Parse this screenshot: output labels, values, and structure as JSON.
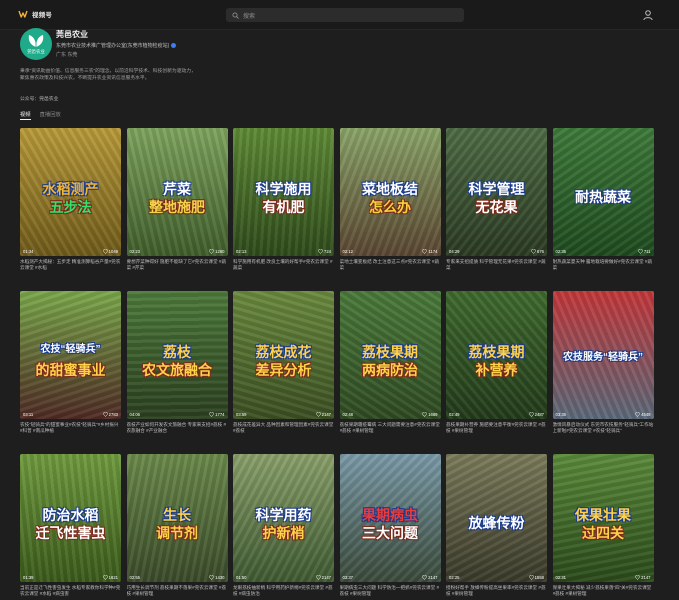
{
  "brand": {
    "name": "视频号"
  },
  "search": {
    "placeholder": "搜索"
  },
  "profile": {
    "avatar_text": "莞邑农业",
    "name": "莞邑农业",
    "desc": "东莞市农业技术推广管理办公室(东莞市植物检疫站)",
    "location": "广东 东莞",
    "bio": "秉承“资讯助益价值、信息服务三农”的理念，以前沿科学技术、科技创新为驱动力，聚焦惠农政策及科技兴农，不断提升农业资讯信息服务水平。",
    "company_label": "公众号：",
    "company_value": "莞邑农业"
  },
  "tabs": [
    {
      "label": "视频",
      "active": true
    },
    {
      "label": "直播回放",
      "active": false
    }
  ],
  "videos": [
    {
      "title_l1": "水稻测产",
      "title_l2": "五步法",
      "duration": "01:34",
      "likes": "1049",
      "caption": "水稻测产大揭秘：五步走 精准测算稻谷产量#莞农云课堂 #水稻",
      "bg": "#b99a3a",
      "bg2": "#6f5a1a",
      "c1": "#f2b533",
      "c2": "#34e26b"
    },
    {
      "title_l1": "芹菜",
      "title_l2": "整地施肥",
      "duration": "02:23",
      "likes": "1260",
      "caption": "要想芹菜种得好 施肥不能缺了它#莞农云课堂 #蔬菜 #芹菜",
      "bg": "#7ea35e",
      "bg2": "#3f5d2a",
      "c1": "#ffffff",
      "c2": "#f2d34a"
    },
    {
      "title_l1": "科学施用",
      "title_l2": "有机肥",
      "duration": "02:13",
      "likes": "724",
      "caption": "科学施用有机肥 改良土壤的好帮手#莞农云课堂 #蔬菜",
      "bg": "#5e8a35",
      "bg2": "#2e4a1a",
      "c1": "#ffffff",
      "c2": "#ffffff"
    },
    {
      "title_l1": "菜地板结",
      "title_l2": "怎么办",
      "duration": "02:12",
      "likes": "1174",
      "caption": "菜地土壤变板结 改土注意这三点#莞农云课堂 #蔬菜",
      "bg": "#8aa468",
      "bg2": "#5a4632",
      "c1": "#ffffff",
      "c2": "#f5d23a"
    },
    {
      "title_l1": "科学管理",
      "title_l2": "无花果",
      "duration": "04:29",
      "likes": "676",
      "caption": "专家来支招提质 科学管理无花果#莞农云课堂 #蔬菜",
      "bg": "#4e6b44",
      "bg2": "#2a3a22",
      "c1": "#ffffff",
      "c2": "#ffffff"
    },
    {
      "title_l1": "耐热蔬菜",
      "title_l2": "",
      "duration": "02:35",
      "likes": "711",
      "caption": "耐热蔬菜夏天种 露地栽培要做好#莞农云课堂 #蔬菜",
      "bg": "#3e7a3a",
      "bg2": "#1e4a1e",
      "c1": "#ffffff",
      "c2": "#ffffff"
    },
    {
      "title_l1": "农技“轻骑兵”",
      "title_l2": "的甜蜜事业",
      "duration": "03:11",
      "likes": "2783",
      "caption": "农技“轻骑兵”的甜蜜事业#农技“轻骑兵”#乡村振兴 #科普 #南瓜种植",
      "bg": "#7aa84a",
      "bg2": "#4e2a24",
      "c1": "#ffffff",
      "c2": "#ffd24a"
    },
    {
      "title_l1": "荔枝",
      "title_l2": "农文旅融合",
      "duration": "04:06",
      "likes": "1774",
      "caption": "荔枝产业如何开发农文旅融合 专家来支招#荔枝 #农旅融合 #产业融合",
      "bg": "#4c7a3a",
      "bg2": "#2b3f1f",
      "c1": "#ffd24a",
      "c2": "#ffd24a"
    },
    {
      "title_l1": "荔枝成花",
      "title_l2": "差异分析",
      "duration": "03:59",
      "likes": "2147",
      "caption": "荔枝成花差异大 品种因素和管理因素#莞农云课堂 #荔枝",
      "bg": "#6a8a3e",
      "bg2": "#3b4f22",
      "c1": "#ffd24a",
      "c2": "#ffd24a"
    },
    {
      "title_l1": "荔枝果期",
      "title_l2": "两病防治",
      "duration": "02:48",
      "likes": "1669",
      "caption": "荔枝果期霜疫霉病 三大问题需要注意#莞农云课堂 #荔枝 #果树管理",
      "bg": "#4a7a3a",
      "bg2": "#2f4a22",
      "c1": "#ffd24a",
      "c2": "#ffd24a"
    },
    {
      "title_l1": "荔枝果期",
      "title_l2": "补营养",
      "duration": "02:49",
      "likes": "2487",
      "caption": "荔枝果期补营养 施肥要注意平衡#莞农云课堂 #荔枝 #果树管理",
      "bg": "#3f6a2e",
      "bg2": "#223a1a",
      "c1": "#ffd24a",
      "c2": "#ffd24a"
    },
    {
      "title_l1": "农技服务“轻骑兵”",
      "title_l2": "",
      "duration": "03:35",
      "likes": "4549",
      "caption": "激情风暴启动仪式 东莞市农技服务“轻骑兵”工作站上新啦#莞农云课堂 #农技“轻骑兵”",
      "bg": "#c4373a",
      "bg2": "#5a6a7a",
      "c1": "#ffffff",
      "c2": "#ffffff"
    },
    {
      "title_l1": "防治水稻",
      "title_l2": "迁飞性害虫",
      "duration": "01:39",
      "likes": "1621",
      "caption": "当前正是迁飞性害虫发生 水稻专家教你科学种#莞农云课堂 #水稻 #病虫害",
      "bg": "#6f9a3e",
      "bg2": "#3a5a1a",
      "c1": "#ffffff",
      "c2": "#ffffff"
    },
    {
      "title_l1": "生长",
      "title_l2": "调节剂",
      "duration": "02:55",
      "likes": "1430",
      "caption": "巧用生长调节剂 荔枝果期不落果#莞农云课堂 #荔枝 #果树管理",
      "bg": "#6a8a4a",
      "bg2": "#3a4a2a",
      "c1": "#ffd24a",
      "c2": "#ffd24a"
    },
    {
      "title_l1": "科学用药",
      "title_l2": "护新梢",
      "duration": "01:50",
      "likes": "2147",
      "caption": "龙眼荔枝抽新梢 科学用药护新梢#莞农云课堂 #荔枝 #病虫防治",
      "bg": "#8aa06a",
      "bg2": "#3f5a32",
      "c1": "#ffffff",
      "c2": "#ffd24a"
    },
    {
      "title_l1": "果期病虫",
      "title_l2": "三大问题",
      "duration": "03:37",
      "likes": "2147",
      "caption": "果期病虫三大问题 科学防治一把抓#莞农云课堂 #荔枝 #果树管理",
      "bg": "#7a9aa8",
      "bg2": "#3a4a3a",
      "c1": "#e83b3b",
      "c2": "#ffffff"
    },
    {
      "title_l1": "放蜂传粉",
      "title_l2": "",
      "duration": "02:25",
      "likes": "1558",
      "caption": "授粉好帮手 放蜂传粉提高坐果率#莞农云课堂 #荔枝 #果树管理",
      "bg": "#7a7a5a",
      "bg2": "#3a3a2a",
      "c1": "#ffffff",
      "c2": "#ffffff"
    },
    {
      "title_l1": "保果壮果",
      "title_l2": "过四关",
      "duration": "02:31",
      "likes": "2147",
      "caption": "保果壮果大揭秘 减少荔枝果落“四”关#莞农云课堂 #荔枝 #果树管理",
      "bg": "#5a8a3a",
      "bg2": "#2a4a1a",
      "c1": "#ffd24a",
      "c2": "#ffd24a"
    }
  ],
  "colors": {
    "background": "#1e1e1e",
    "accent": "#3d7cf5",
    "brand_green": "#1faa8a"
  }
}
